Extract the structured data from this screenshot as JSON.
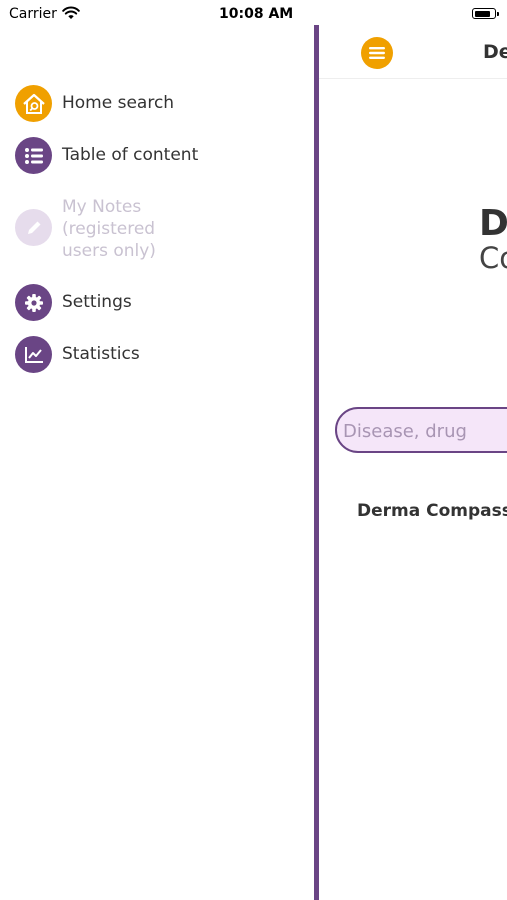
{
  "status_bar": {
    "carrier": "Carrier",
    "time": "10:08 AM",
    "battery_level": 0.85
  },
  "menu": {
    "items": [
      {
        "label": "Home search",
        "icon": "home-search-icon",
        "color": "#f0a000",
        "enabled": true
      },
      {
        "label": "Table of content",
        "icon": "list-icon",
        "color": "#6a4585",
        "enabled": true
      },
      {
        "label": "My Notes (registered users only)",
        "icon": "pencil-icon",
        "color": "#e6dcec",
        "enabled": false
      },
      {
        "label": "Settings",
        "icon": "gear-icon",
        "color": "#6a4585",
        "enabled": true
      },
      {
        "label": "Statistics",
        "icon": "chart-icon",
        "color": "#6a4585",
        "enabled": true
      }
    ]
  },
  "main": {
    "header_title": "De",
    "brand_line1": "D",
    "brand_line2": "Co",
    "search_placeholder": "Disease, drug",
    "footer_text": "Derma Compass"
  },
  "colors": {
    "accent": "#6a4585",
    "orange": "#f0a000",
    "search_bg": "#f5e6f9"
  }
}
